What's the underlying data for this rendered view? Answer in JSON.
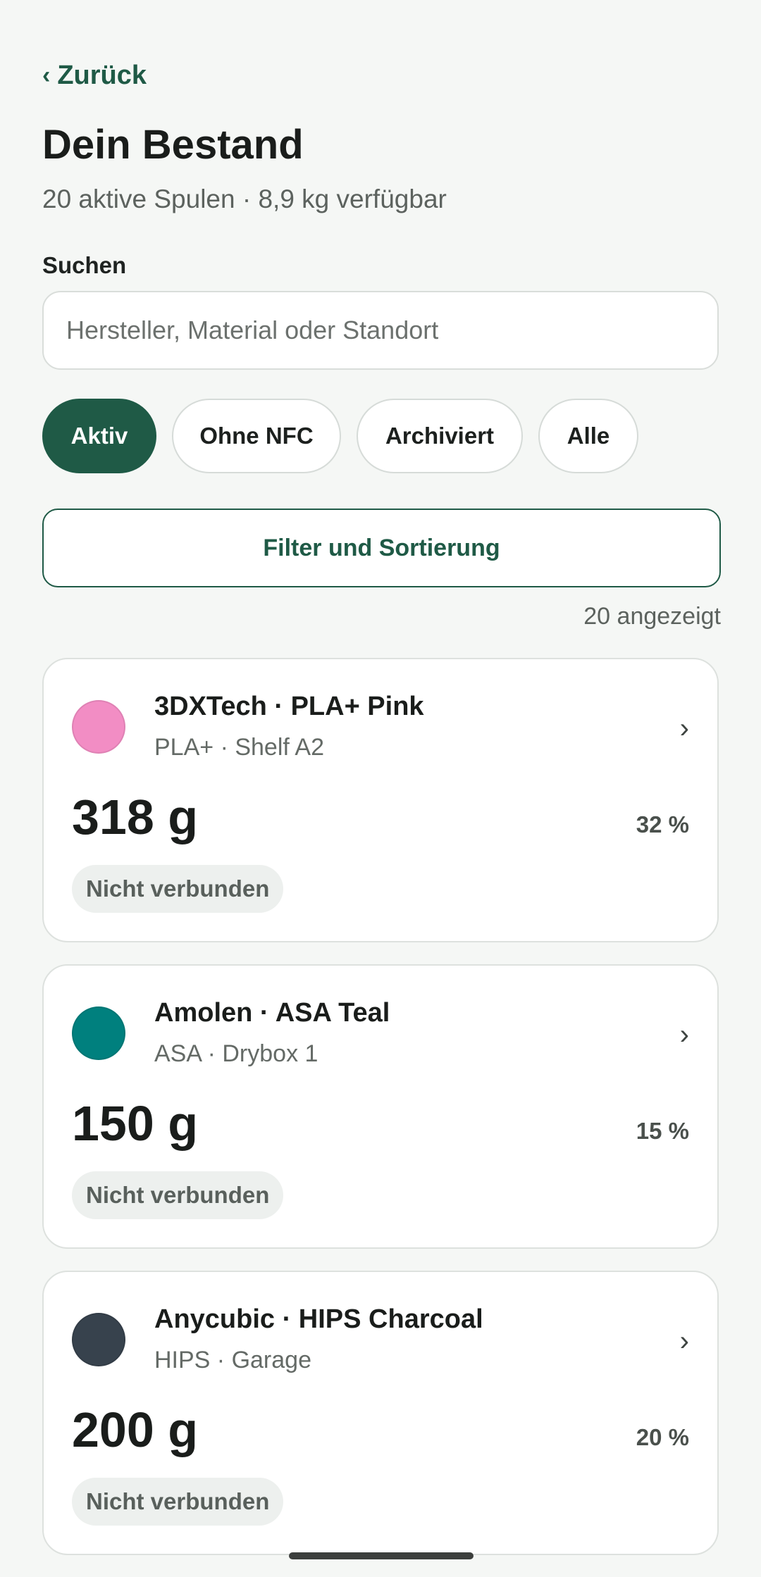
{
  "header": {
    "back_label": "Zurück",
    "title": "Dein Bestand",
    "subtitle": "20 aktive Spulen · 8,9 kg verfügbar"
  },
  "search": {
    "label": "Suchen",
    "placeholder": "Hersteller, Material oder Standort",
    "value": ""
  },
  "chips": [
    {
      "label": "Aktiv",
      "active": true
    },
    {
      "label": "Ohne NFC",
      "active": false
    },
    {
      "label": "Archiviert",
      "active": false
    },
    {
      "label": "Alle",
      "active": false
    }
  ],
  "filter_button": "Filter und Sortierung",
  "shown_count": "20 angezeigt",
  "spools": [
    {
      "name": "3DXTech · PLA+ Pink",
      "meta": "PLA+ · Shelf A2",
      "weight": "318 g",
      "percent": "32 %",
      "status": "Nicht verbunden",
      "color": "#f28dc4"
    },
    {
      "name": "Amolen · ASA Teal",
      "meta": "ASA · Drybox 1",
      "weight": "150 g",
      "percent": "15 %",
      "status": "Nicht verbunden",
      "color": "#00807e"
    },
    {
      "name": "Anycubic · HIPS Charcoal",
      "meta": "HIPS · Garage",
      "weight": "200 g",
      "percent": "20 %",
      "status": "Nicht verbunden",
      "color": "#37424d"
    }
  ],
  "colors": {
    "accent": "#1f5a46",
    "background": "#f5f7f5"
  }
}
